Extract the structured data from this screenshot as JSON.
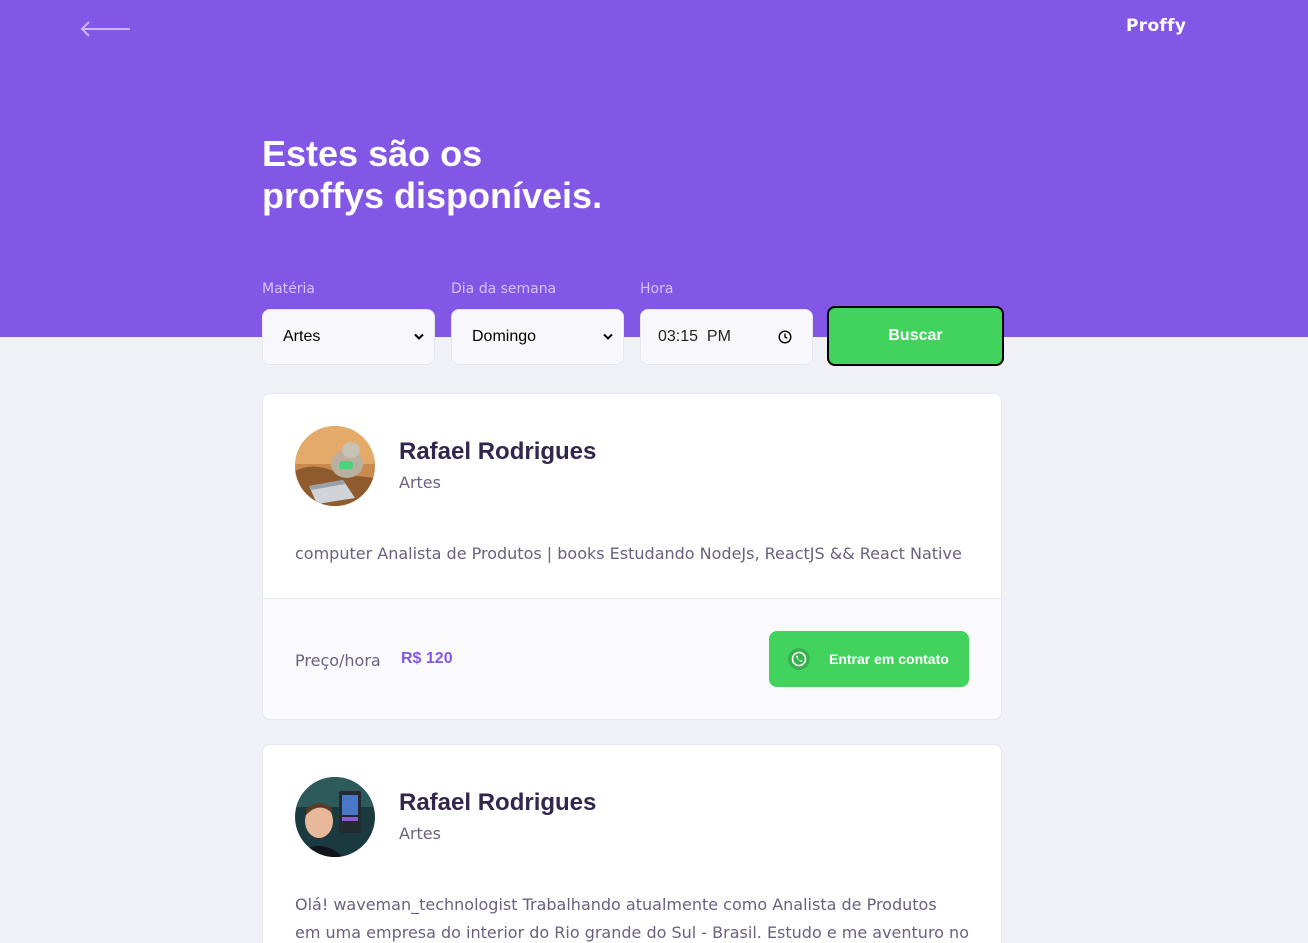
{
  "header": {
    "logo": "Proffy",
    "back_icon": "arrow-left-icon"
  },
  "hero": {
    "title_line1": "Estes são os",
    "title_line2": "proffys disponíveis."
  },
  "filters": {
    "subject": {
      "label": "Matéria",
      "value": "Artes"
    },
    "weekday": {
      "label": "Dia da semana",
      "value": "Domingo"
    },
    "time": {
      "label": "Hora",
      "value": "03:15  PM"
    },
    "submit_label": "Buscar"
  },
  "teachers": [
    {
      "name": "Rafael Rodrigues",
      "subject": "Artes",
      "bio_lines": [
        "computer Analista de Produtos | books Estudando NodeJs, ReactJS && React Native"
      ],
      "price_label": "Preço/hora",
      "price": "R$ 120",
      "contact_label": "Entrar em contato"
    },
    {
      "name": "Rafael Rodrigues",
      "subject": "Artes",
      "bio_lines": [
        "Olá! waveman_technologist Trabalhando atualmente como Analista de Produtos",
        "em uma empresa do interior do Rio grande do Sul - Brasil. Estudo e me aventuro no"
      ]
    }
  ],
  "colors": {
    "primary": "#8257e5",
    "secondary": "#42d35e",
    "background": "#f0f0f7",
    "title_text": "#32264d",
    "body_text": "#6a6180"
  }
}
